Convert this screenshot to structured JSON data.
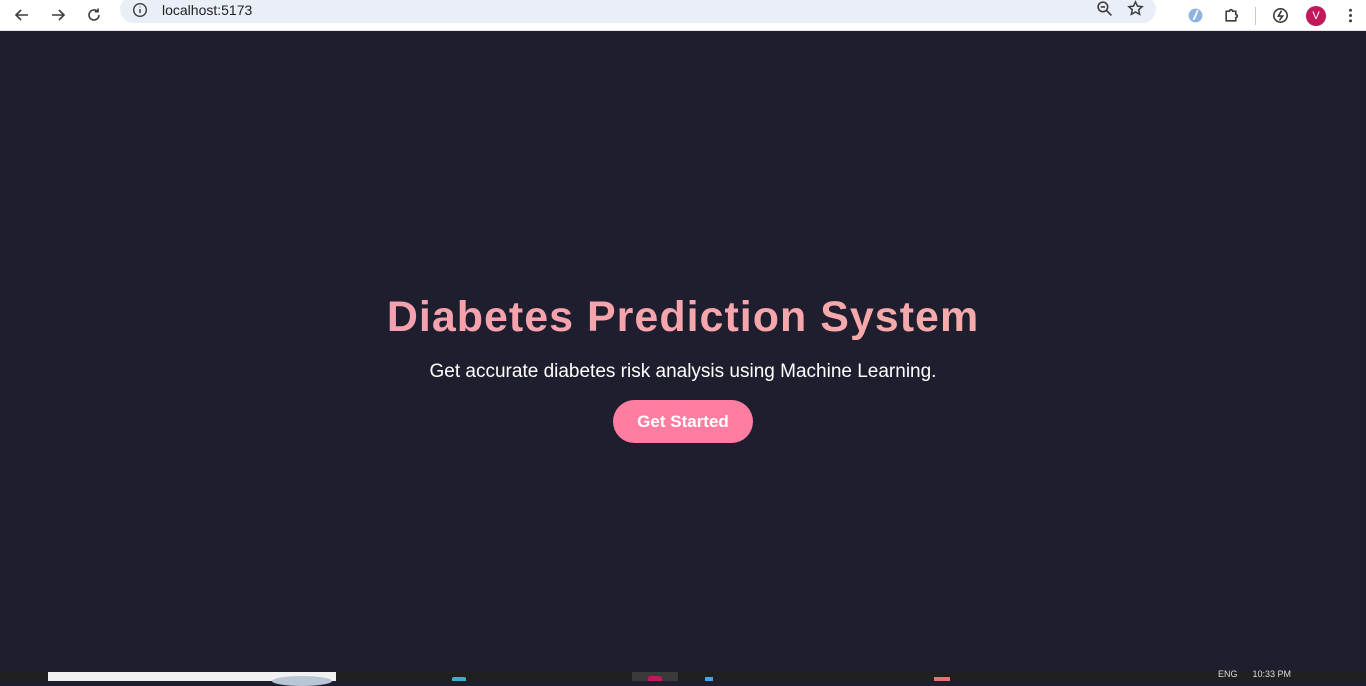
{
  "browser": {
    "url": "localhost:5173",
    "profile_initial": "V",
    "icons": {
      "back": "arrow-left-icon",
      "forward": "arrow-right-icon",
      "reload": "reload-icon",
      "site_info": "info-icon",
      "zoom": "zoom-icon",
      "bookmark": "star-icon",
      "extension1": "extension-icon",
      "extensions": "puzzle-icon",
      "performance": "performance-icon",
      "menu": "kebab-menu-icon"
    }
  },
  "hero": {
    "title": "Diabetes Prediction System",
    "subtitle": "Get accurate diabetes risk analysis using Machine Learning.",
    "cta_label": "Get Started"
  },
  "taskbar": {
    "tray_lang": "ENG",
    "tray_time": "10:33 PM"
  },
  "colors": {
    "page_background": "#1e1e2e",
    "title_gradient_start": "#f49ab0",
    "title_gradient_end": "#f7b1a8",
    "cta_background": "#ff7da0"
  }
}
